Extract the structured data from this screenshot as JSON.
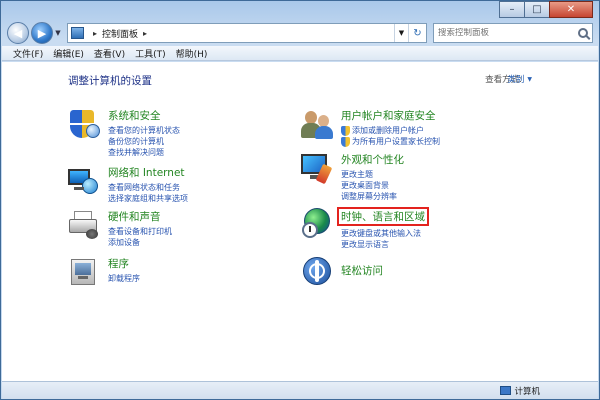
{
  "window": {
    "caption_buttons": [
      "minimize",
      "maximize",
      "close"
    ]
  },
  "address_bar": {
    "path": "控制面板",
    "search_placeholder": "搜索控制面板"
  },
  "menu": [
    "文件(F)",
    "编辑(E)",
    "查看(V)",
    "工具(T)",
    "帮助(H)"
  ],
  "main": {
    "title": "调整计算机的设置",
    "view_by_label": "查看方式:",
    "view_by_value": "类别"
  },
  "categories": {
    "security": {
      "title": "系统和安全",
      "links": [
        "查看您的计算机状态",
        "备份您的计算机",
        "查找并解决问题"
      ]
    },
    "network": {
      "title": "网络和 Internet",
      "links": [
        "查看网络状态和任务",
        "选择家庭组和共享选项"
      ]
    },
    "hardware": {
      "title": "硬件和声音",
      "links": [
        "查看设备和打印机",
        "添加设备"
      ]
    },
    "programs": {
      "title": "程序",
      "links": [
        "卸载程序"
      ]
    },
    "users": {
      "title": "用户帐户和家庭安全",
      "links": [
        "添加或删除用户帐户",
        "为所有用户设置家长控制"
      ]
    },
    "appearance": {
      "title": "外观和个性化",
      "links": [
        "更改主题",
        "更改桌面背景",
        "调整屏幕分辨率"
      ]
    },
    "clock": {
      "title": "时钟、语言和区域",
      "links": [
        "更改键盘或其他输入法",
        "更改显示语言"
      ]
    },
    "access": {
      "title": "轻松访问"
    }
  },
  "statusbar": {
    "text": "计算机"
  }
}
